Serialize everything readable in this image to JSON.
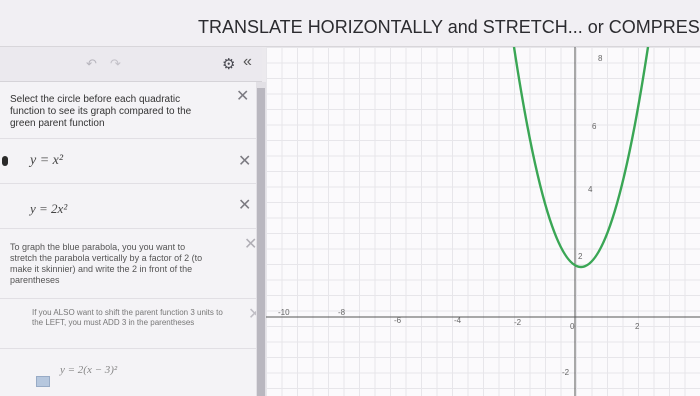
{
  "title": "TRANSLATE HORIZONTALLY and STRETCH... or COMPRESS",
  "toolbar": {
    "undo_icon": "undo-icon",
    "redo_icon": "redo-icon",
    "settings_icon": "gear-icon",
    "collapse_label": "«"
  },
  "expressions": {
    "note1": "Select the circle before each quadratic function to see its graph compared to the green parent function",
    "eq1": "y = x²",
    "eq2": "y = 2x²",
    "note2": "To graph the blue parabola, you you want to stretch the parabola vertically by a factor of 2 (to make it skinnier) and write the 2 in front of the parentheses",
    "note3": "If you ALSO want to shift the parent function 3 units to the LEFT, you must ADD 3 in the parentheses",
    "eq3": "y = 2(x − 3)²",
    "delete_symbol": "✕"
  },
  "graph": {
    "x_ticks": [
      "-10",
      "-8",
      "-6",
      "-4",
      "-2",
      "0",
      "2"
    ],
    "y_ticks": [
      "8",
      "6",
      "4",
      "2",
      "-2"
    ],
    "parent_color": "#3aa655",
    "blue_color": "#3a6db3"
  }
}
